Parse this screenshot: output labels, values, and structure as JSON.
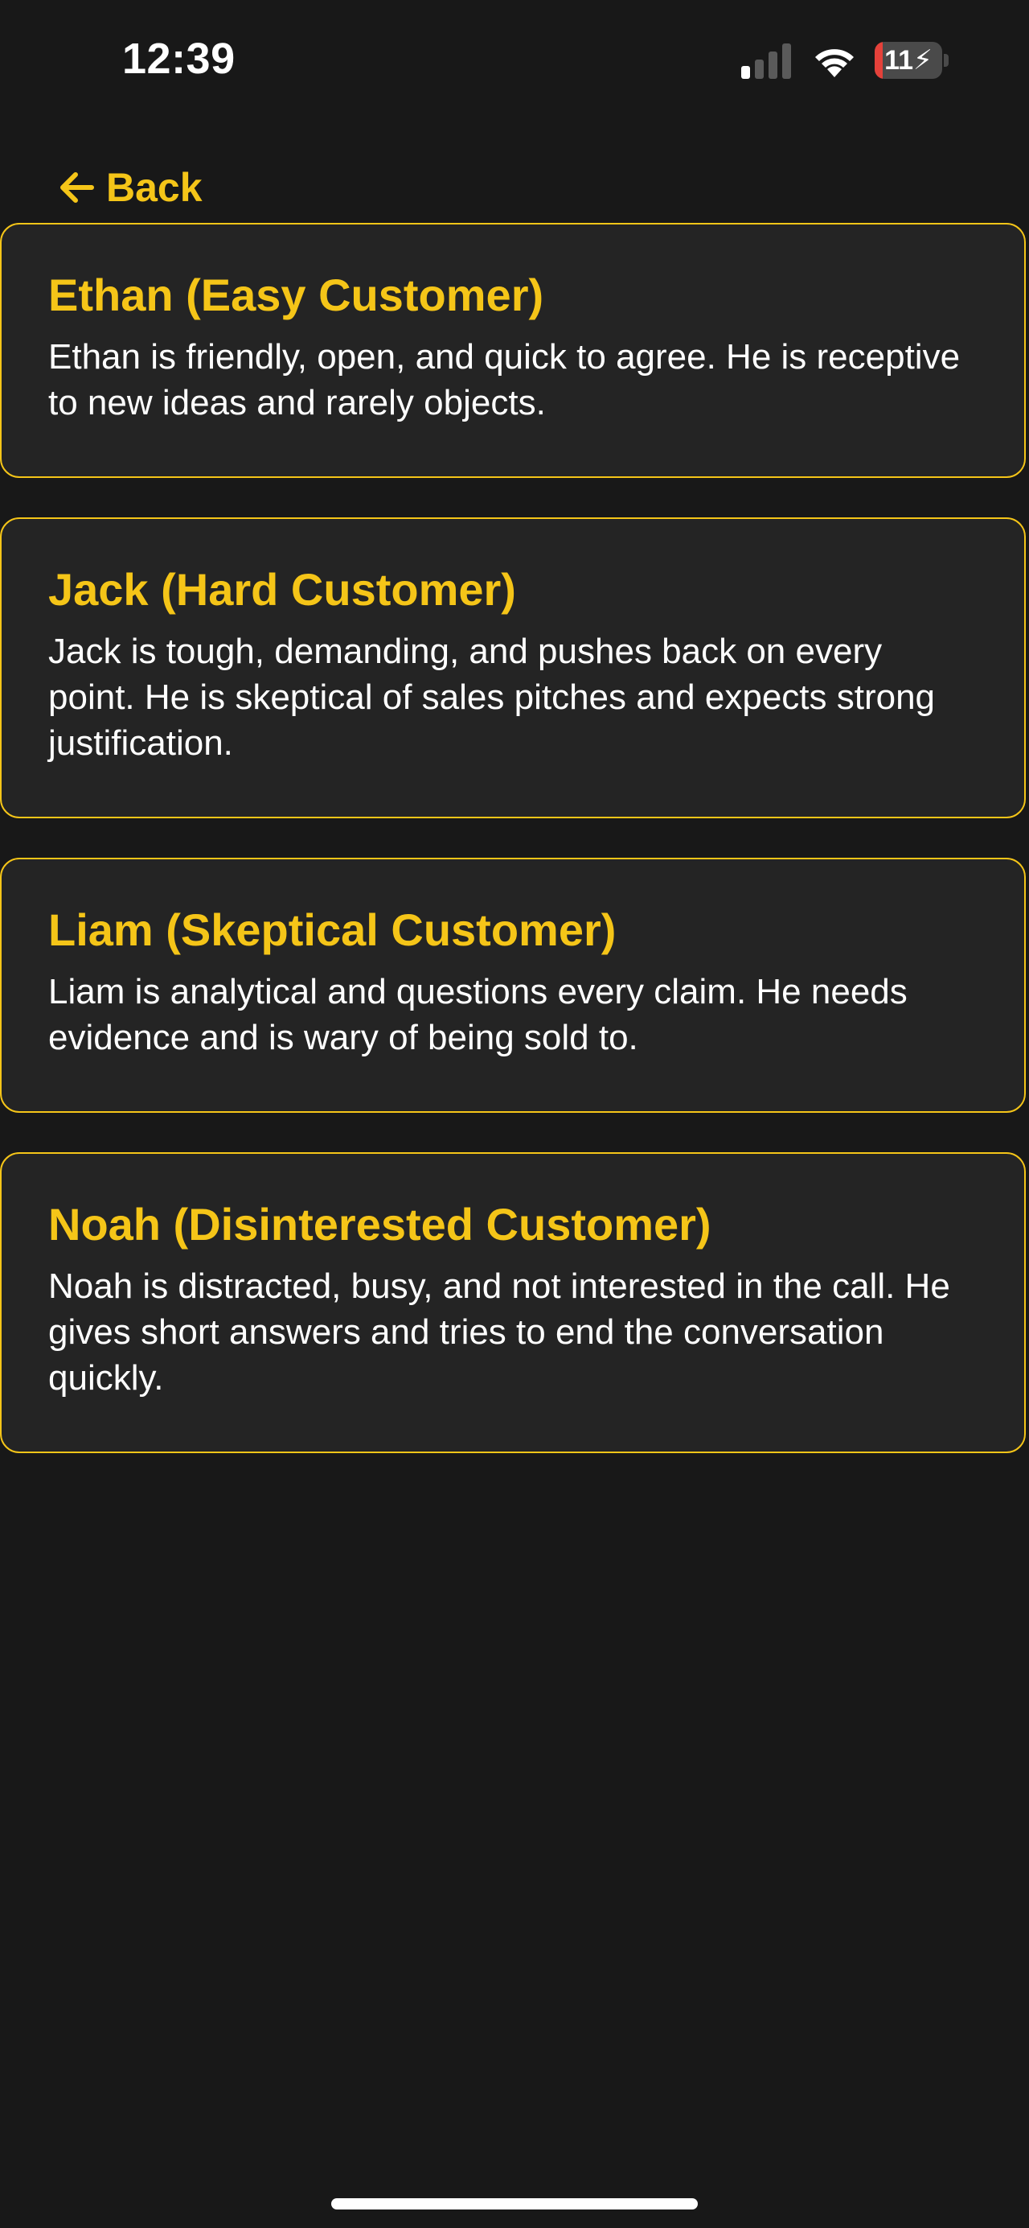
{
  "status_bar": {
    "time": "12:39",
    "battery_level": "11",
    "battery_fraction": 0.11,
    "signal_bars_active": 1,
    "signal_bars_total": 4,
    "icons": [
      "signal-icon",
      "wifi-icon",
      "battery-charging-icon"
    ]
  },
  "nav": {
    "back_label": "Back",
    "back_icon": "arrow-left-icon"
  },
  "colors": {
    "background": "#181818",
    "card_background": "#242424",
    "accent": "#f5c518",
    "text": "#ffffff",
    "battery_low": "#e5413a"
  },
  "customers": [
    {
      "title": "Ethan (Easy Customer)",
      "description": "Ethan is friendly, open, and quick to agree. He is receptive to new ideas and rarely objects."
    },
    {
      "title": "Jack (Hard Customer)",
      "description": "Jack is tough, demanding, and pushes back on every point. He is skeptical of sales pitches and expects strong justification."
    },
    {
      "title": "Liam (Skeptical Customer)",
      "description": "Liam is analytical and questions every claim. He needs evidence and is wary of being sold to."
    },
    {
      "title": "Noah (Disinterested Customer)",
      "description": "Noah is distracted, busy, and not interested in the call. He gives short answers and tries to end the conversation quickly."
    }
  ]
}
